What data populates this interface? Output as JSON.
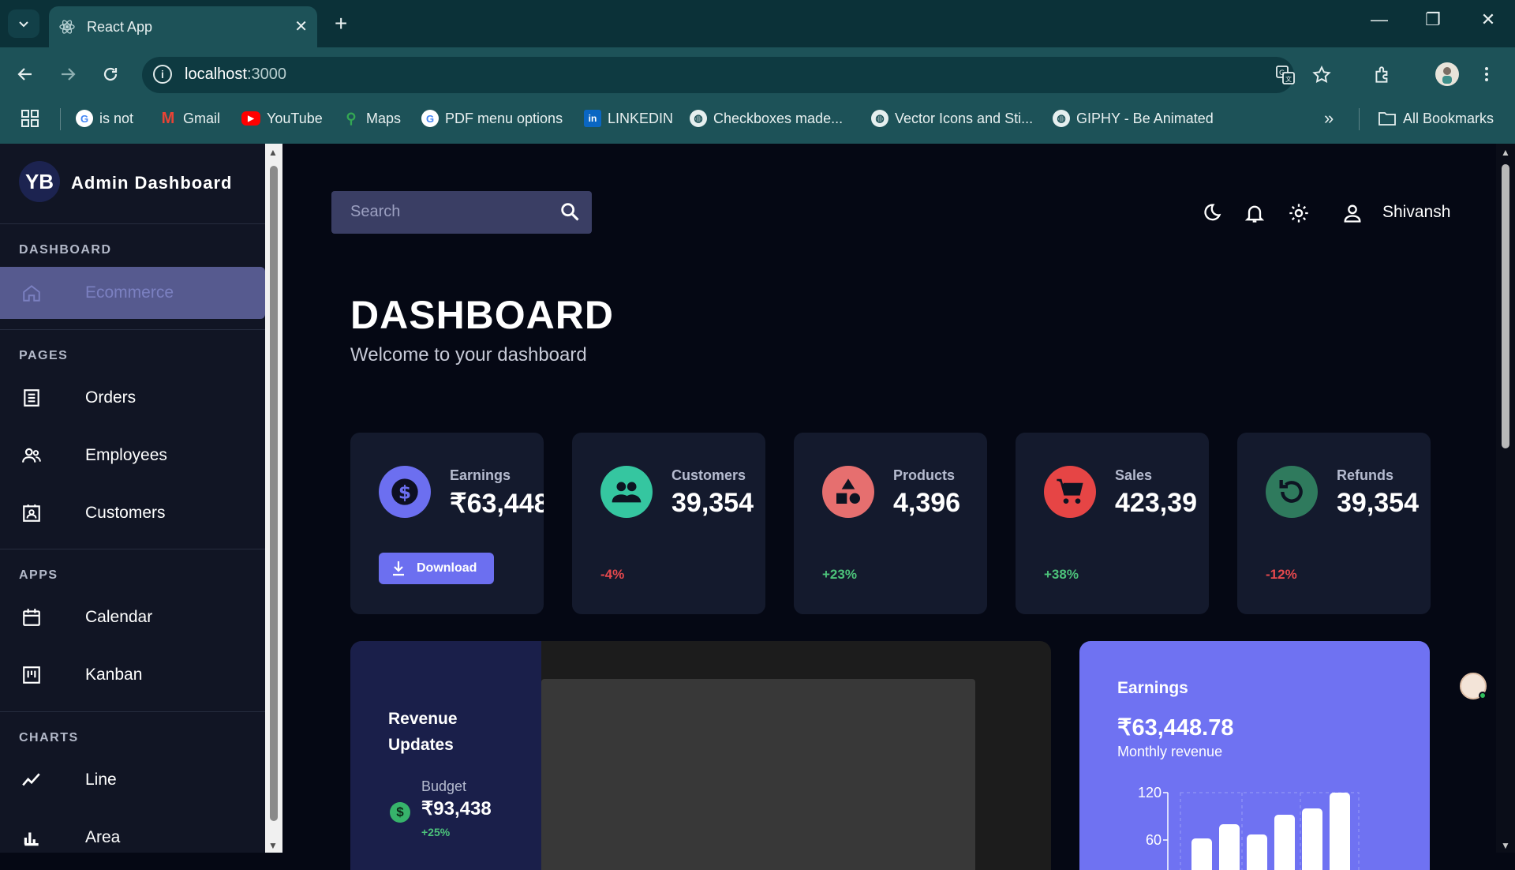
{
  "browser": {
    "tab_title": "React App",
    "url_host": "localhost",
    "url_port": ":3000",
    "bookmarks": [
      {
        "label": "is not",
        "icon": "google-icon"
      },
      {
        "label": "Gmail",
        "icon": "gmail-icon"
      },
      {
        "label": "YouTube",
        "icon": "youtube-icon"
      },
      {
        "label": "Maps",
        "icon": "maps-icon"
      },
      {
        "label": "PDF menu options",
        "icon": "google-icon"
      },
      {
        "label": "LINKEDIN",
        "icon": "linkedin-icon"
      },
      {
        "label": "Checkboxes made...",
        "icon": "globe-icon"
      },
      {
        "label": "Vector Icons and Sti...",
        "icon": "globe-icon"
      },
      {
        "label": "GIPHY - Be Animated",
        "icon": "globe-icon"
      }
    ],
    "all_bookmarks": "All Bookmarks"
  },
  "sidebar": {
    "logo_initials": "YB",
    "brand": "Admin Dashboard",
    "sections": {
      "dashboard": "DASHBOARD",
      "pages": "PAGES",
      "apps": "APPS",
      "charts": "CHARTS"
    },
    "items": {
      "ecommerce": "Ecommerce",
      "orders": "Orders",
      "employees": "Employees",
      "customers": "Customers",
      "calendar": "Calendar",
      "kanban": "Kanban",
      "line": "Line",
      "area": "Area"
    }
  },
  "header": {
    "search_placeholder": "Search",
    "username": "Shivansh"
  },
  "page": {
    "title": "DASHBOARD",
    "subtitle": "Welcome to your dashboard"
  },
  "cards": [
    {
      "label": "Earnings",
      "value": "₹63,448",
      "button": "Download",
      "color": "#6c6ff0"
    },
    {
      "label": "Customers",
      "value": "39,354",
      "change": "-4%",
      "change_color": "#e5484d",
      "color": "#35c6a0"
    },
    {
      "label": "Products",
      "value": "4,396",
      "change": "+23%",
      "change_color": "#4cc27a",
      "color": "#e66f6f"
    },
    {
      "label": "Sales",
      "value": "423,39",
      "change": "+38%",
      "change_color": "#4cc27a",
      "color": "#e64545"
    },
    {
      "label": "Refunds",
      "value": "39,354",
      "change": "-12%",
      "change_color": "#e5484d",
      "color": "#2f7a5d"
    }
  ],
  "revenue": {
    "title": "Revenue Updates",
    "budget_label": "Budget",
    "budget_value": "₹93,438",
    "budget_change": "+25%"
  },
  "earnings_panel": {
    "title": "Earnings",
    "value": "₹63,448.78",
    "subtitle": "Monthly revenue"
  },
  "chart_data": {
    "type": "bar",
    "title": "",
    "ytick_labels": [
      "120",
      "60"
    ],
    "values": [
      62,
      80,
      67,
      92,
      100,
      120
    ],
    "ylim": [
      60,
      120
    ]
  },
  "colors": {
    "background": "#050814",
    "sidebar": "#111524",
    "accent": "#6c6ff0"
  }
}
